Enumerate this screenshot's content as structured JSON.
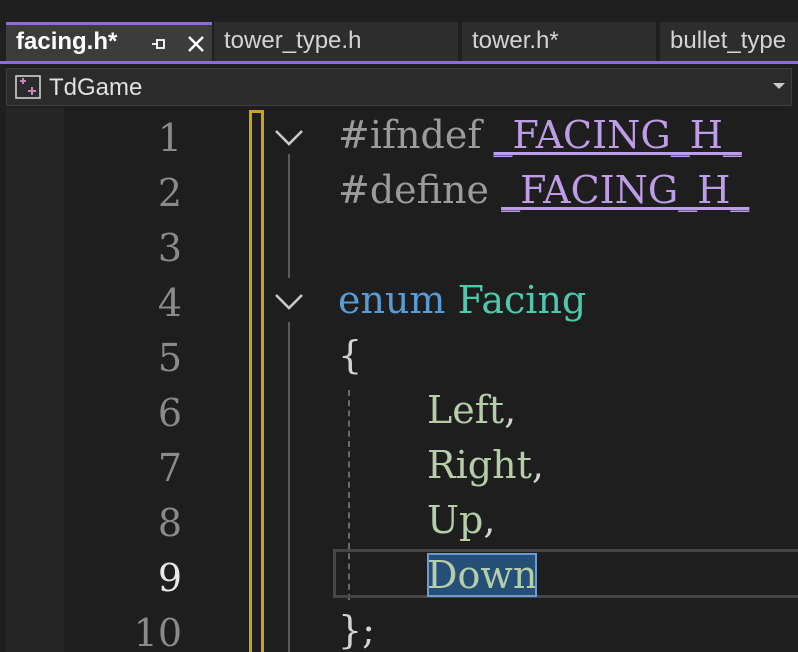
{
  "tabs": [
    {
      "label": "facing.h*",
      "active": true
    },
    {
      "label": "tower_type.h",
      "active": false
    },
    {
      "label": "tower.h*",
      "active": false
    },
    {
      "label": "bullet_type",
      "active": false
    }
  ],
  "project": {
    "name": "TdGame"
  },
  "line_numbers": [
    "1",
    "2",
    "3",
    "4",
    "5",
    "6",
    "7",
    "8",
    "9",
    "10"
  ],
  "current_line": "9",
  "code": {
    "l1": {
      "directive": "#ifndef",
      "macro": "_FACING_H_"
    },
    "l2": {
      "directive": "#define",
      "macro": "_FACING_H_"
    },
    "l4": {
      "keyword": "enum",
      "type": "Facing"
    },
    "l5": {
      "text": "{"
    },
    "l6": {
      "value": "Left",
      "punct": ","
    },
    "l7": {
      "value": "Right",
      "punct": ","
    },
    "l8": {
      "value": "Up",
      "punct": ","
    },
    "l9": {
      "value": "Down"
    },
    "l10": {
      "text": "};"
    }
  },
  "colors": {
    "accent": "#8f6bd6",
    "change_marker": "#c9a41a",
    "selection": "#264f78",
    "keyword": "#569cd6",
    "type": "#4ec9b0",
    "macro": "#bd9ce8",
    "enum_value": "#b5cea8"
  },
  "icons": {
    "pin": "pin-icon",
    "close": "close-icon",
    "project": "project-icon",
    "dropdown": "chevron-down-icon",
    "fold": "fold-chevron-icon"
  }
}
